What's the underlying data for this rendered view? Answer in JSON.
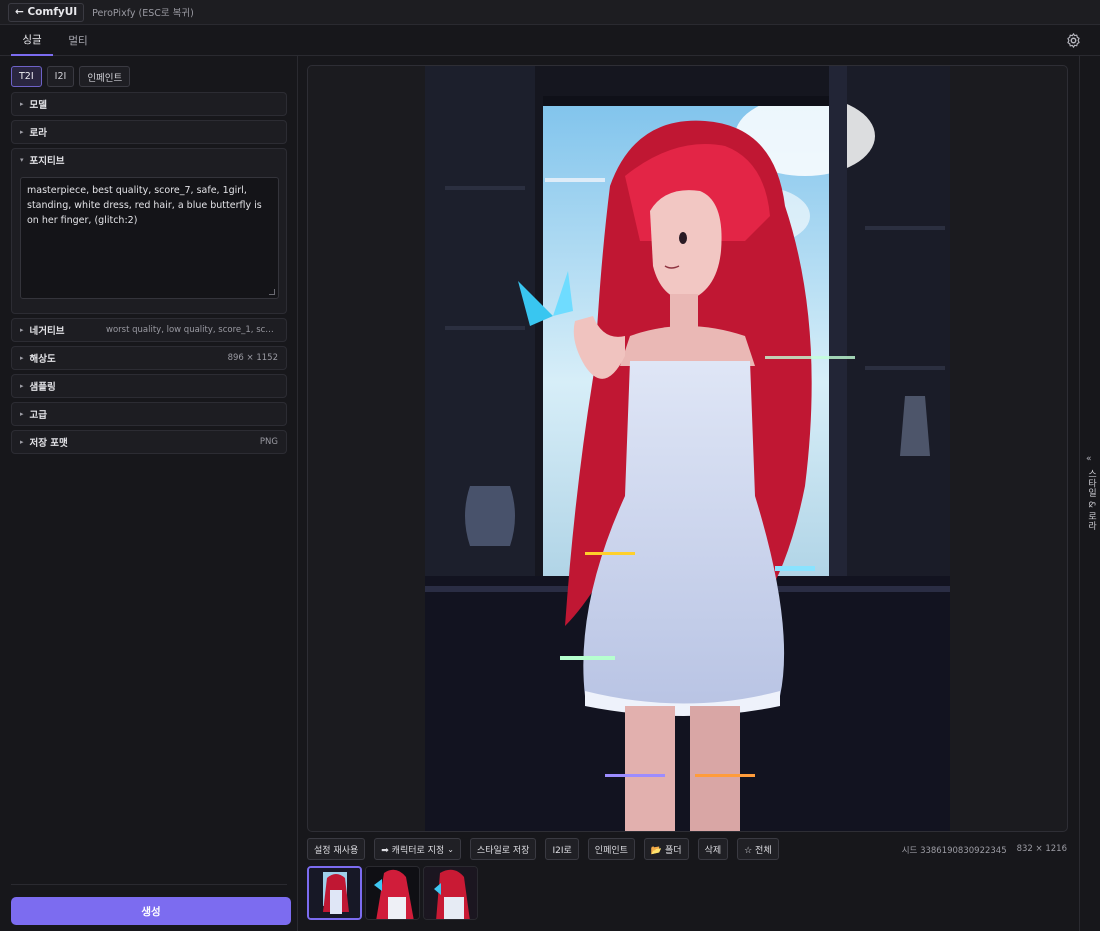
{
  "topbar": {
    "back_label": "← ComfyUI",
    "subtitle": "PeroPixfy (ESC로 복귀)"
  },
  "tabs": [
    {
      "label": "싱글",
      "active": true
    },
    {
      "label": "멀티",
      "active": false
    }
  ],
  "modes": [
    {
      "label": "T2I",
      "active": true
    },
    {
      "label": "I2I",
      "active": false
    },
    {
      "label": "인페인트",
      "active": false
    }
  ],
  "sections": {
    "model": {
      "label": "모델"
    },
    "lora": {
      "label": "로라"
    },
    "positive": {
      "label": "포지티브",
      "value": "masterpiece, best quality, score_7, safe, 1girl, standing, white dress, red hair, a blue butterfly is on her finger, (glitch:2)"
    },
    "negative": {
      "label": "네거티브",
      "summary": "worst quality, low quality, score_1, score_2, sc..."
    },
    "resolution": {
      "label": "해상도",
      "summary": "896 × 1152"
    },
    "sampling": {
      "label": "샘플링"
    },
    "advanced": {
      "label": "고급"
    },
    "save_format": {
      "label": "저장 포맷",
      "summary": "PNG"
    }
  },
  "generate_label": "생성",
  "actions": {
    "reuse": "설정 재사용",
    "character_select": "➡ 캐릭터로 지정",
    "save_style": "스타일로 저장",
    "to_i2i": "I2I로",
    "inpaint": "인페인트",
    "folder": "📂 폴더",
    "delete": "삭제",
    "all": "☆ 전체"
  },
  "meta": {
    "seed": "시드 3386190830922345",
    "size": "832 × 1216"
  },
  "right_panel": {
    "arrow": "«",
    "label": "스타일 & 로라"
  },
  "colors": {
    "accent": "#7c6cf0",
    "background": "#17171b",
    "panel": "#1d1d22"
  }
}
